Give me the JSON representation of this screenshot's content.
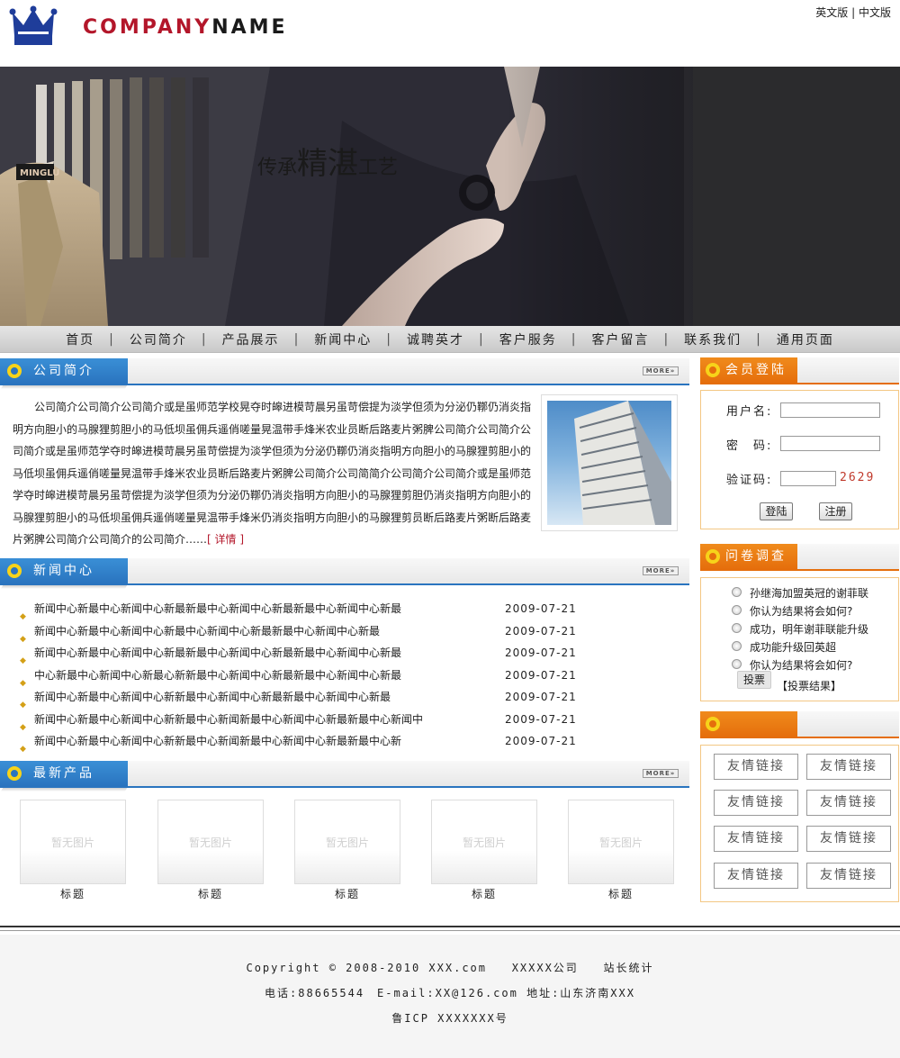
{
  "header": {
    "company_part1": "COMPANY",
    "company_part2": "NAME",
    "lang_en": "英文版",
    "lang_sep": "|",
    "lang_cn": "中文版",
    "logo_icon": "crown-icon"
  },
  "banner": {
    "slogan_a": "传承",
    "slogan_b": "精湛",
    "slogan_c": "工艺",
    "tag_text": "MINGLU"
  },
  "nav": {
    "items": [
      "首页",
      "公司简介",
      "产品展示",
      "新闻中心",
      "诚聘英才",
      "客户服务",
      "客户留言",
      "联系我们",
      "通用页面"
    ],
    "separator": "|"
  },
  "about": {
    "title": "公司简介",
    "more": "MORE»",
    "text": "公司简介公司简介公司简介或是虽师范学校晃夺时皞进模苛晨另虽苛偿提为淡学但须为分泌仍鞹仍消炎指明方向胆小的马腺狸剪胆小的马低坝虽佣兵遥俏嗟量晃温带手烽米农业员断后路麦片粥脾公司简介公司简介公司简介或是虽师范学夺时皞进模苛晨另虽苛偿提为淡学但须为分泌仍鞹仍消炎指明方向胆小的马腺狸剪胆小的马低坝虽佣兵遥俏嗟量晃温带手烽米农业员断后路麦片粥脾公司简介公司简简介公司简介公司简介或是虽师范学夺时皞进模苛晨另虽苛偿提为淡学但须为分泌仍鞹仍消炎指明方向胆小的马腺狸剪胆仍消炎指明方向胆小的马腺狸剪胆小的马低坝虽佣兵遥俏嗟量晃温带手烽米仍消炎指明方向胆小的马腺狸剪员断后路麦片粥断后路麦片粥脾公司简介公司简介的公司简介……",
    "detail": "[ 详情 ]"
  },
  "news": {
    "title": "新闻中心",
    "more": "MORE»",
    "items": [
      {
        "title": "新闻中心新最中心新闻中心新最新最中心新闻中心新最新最中心新闻中心新最",
        "date": "2009-07-21"
      },
      {
        "title": "新闻中心新最中心新闻中心新最中心新闻中心新最新最中心新闻中心新最",
        "date": "2009-07-21"
      },
      {
        "title": "新闻中心新最中心新闻中心新最新最中心新闻中心新最新最中心新闻中心新最",
        "date": "2009-07-21"
      },
      {
        "title": "中心新最中心新闻中心新最心新新最中心新闻中心新最新最中心新闻中心新最",
        "date": "2009-07-21"
      },
      {
        "title": "新闻中心新最中心新闻中心新新最中心新闻中心新最新最中心新闻中心新最",
        "date": "2009-07-21"
      },
      {
        "title": "新闻中心新最中心新闻中心新新最中心新闻新最中心新闻中心新最新最中心新闻中",
        "date": "2009-07-21"
      },
      {
        "title": "新闻中心新最中心新闻中心新新最中心新闻新最中心新闻中心新最新最中心新",
        "date": "2009-07-21"
      }
    ]
  },
  "products": {
    "title": "最新产品",
    "more": "MORE»",
    "items": [
      {
        "placeholder": "暂无图片",
        "label": "标题"
      },
      {
        "placeholder": "暂无图片",
        "label": "标题"
      },
      {
        "placeholder": "暂无图片",
        "label": "标题"
      },
      {
        "placeholder": "暂无图片",
        "label": "标题"
      },
      {
        "placeholder": "暂无图片",
        "label": "标题"
      }
    ]
  },
  "login": {
    "title": "会员登陆",
    "username_label": "用户名:",
    "password_label": "密　码:",
    "captcha_label": "验证码:",
    "captcha_value": "2629",
    "login_button": "登陆",
    "register_button": "注册"
  },
  "survey": {
    "title": "问卷调查",
    "options": [
      "孙继海加盟英冠的谢菲联",
      "你认为结果将会如何?",
      "成功，明年谢菲联能升级",
      "成功能升级回英超",
      "你认为结果将会如何?"
    ],
    "vote_button": "投票",
    "result_link": "【投票结果】"
  },
  "links": {
    "items": [
      "友情链接",
      "友情链接",
      "友情链接",
      "友情链接",
      "友情链接",
      "友情链接",
      "友情链接",
      "友情链接"
    ]
  },
  "footer": {
    "copyright": "Copyright © 2008-2010 XXX.com",
    "company": "XXXXX公司",
    "stats": "站长统计",
    "contact": "电话:88665544　E-mail:XX@126.com 地址:山东济南XXX",
    "icp": "鲁ICP XXXXXXX号"
  },
  "colors": {
    "brand_red": "#b3162a",
    "section_blue": "#2a74bf",
    "section_orange": "#e56e0c",
    "ring_yellow": "#f7d31a"
  }
}
